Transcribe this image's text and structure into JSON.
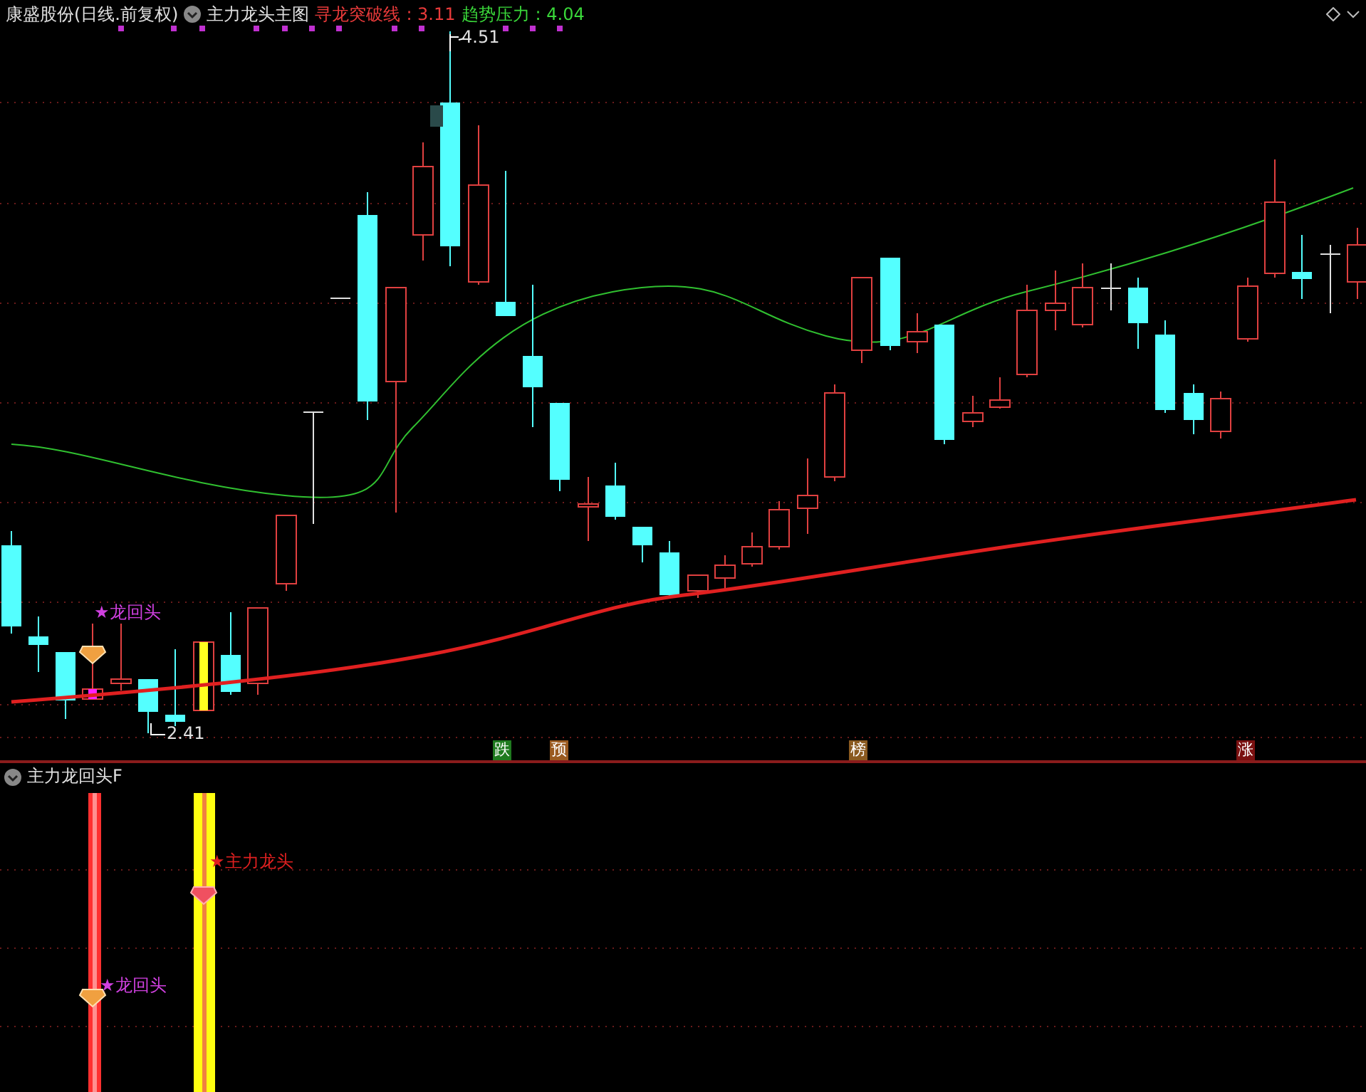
{
  "header": {
    "stock_title": "康盛股份(日线.前复权)",
    "indicator_name": "主力龙头主图",
    "legend": [
      {
        "label": "寻龙突破线",
        "value": ": 3.11",
        "color": "#e83a3a"
      },
      {
        "label": "趋势压力",
        "value": ": 4.04",
        "color": "#3ad83a"
      }
    ]
  },
  "main_chart": {
    "high_label": "4.51",
    "low_label": "2.41",
    "signal_label": "★龙回头",
    "signal_markers": [
      {
        "text": "跌",
        "color": "#1f7a1f"
      },
      {
        "text": "预",
        "color": "#9a5a20"
      },
      {
        "text": "榜",
        "color": "#8a5a20"
      },
      {
        "text": "涨",
        "color": "#7a1010"
      }
    ]
  },
  "sub_chart": {
    "title": "主力龙回头F",
    "labels": [
      {
        "text": "★主力龙头",
        "color": "#e02020"
      },
      {
        "text": "★龙回头",
        "color": "#d040e0"
      }
    ]
  }
}
